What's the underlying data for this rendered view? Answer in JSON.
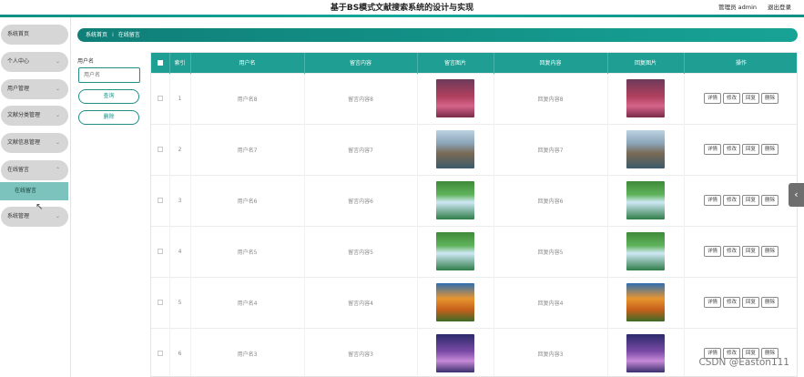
{
  "header": {
    "title": "基于BS模式文献搜索系统的设计与实现",
    "user": "管理员 admin",
    "logout": "退出登录"
  },
  "sidebar": {
    "items": [
      {
        "label": "系统首页",
        "chevron": ""
      },
      {
        "label": "个人中心",
        "chevron": "⌄"
      },
      {
        "label": "用户管理",
        "chevron": "⌄"
      },
      {
        "label": "文献分类管理",
        "chevron": "⌄"
      },
      {
        "label": "文献信息管理",
        "chevron": "⌄"
      },
      {
        "label": "在线留言",
        "chevron": "⌃"
      },
      {
        "label": "系统管理",
        "chevron": "⌄"
      }
    ],
    "active_sub": "在线留言"
  },
  "breadcrumb": {
    "home": "系统首页",
    "sep": "⁞",
    "current": "在线留言"
  },
  "search": {
    "label": "用户名",
    "placeholder": "用户名",
    "query_btn": "查询",
    "delete_btn": "删除"
  },
  "table": {
    "headers": [
      "索引",
      "用户名",
      "留言内容",
      "留言图片",
      "回复内容",
      "回复图片",
      "操作"
    ],
    "actions": [
      "详情",
      "修改",
      "回复",
      "删除"
    ],
    "rows": [
      {
        "index": "1",
        "user": "用户名8",
        "content": "留言内容8",
        "reply": "回复内容8",
        "img": "tree-pink"
      },
      {
        "index": "2",
        "user": "用户名7",
        "content": "留言内容7",
        "reply": "回复内容7",
        "img": "sea-arch"
      },
      {
        "index": "3",
        "user": "用户名6",
        "content": "留言内容6",
        "reply": "回复内容6",
        "img": "waterfall"
      },
      {
        "index": "4",
        "user": "用户名5",
        "content": "留言内容5",
        "reply": "回复内容5",
        "img": "waterfall"
      },
      {
        "index": "5",
        "user": "用户名4",
        "content": "留言内容4",
        "reply": "回复内容4",
        "img": "autumn-tree"
      },
      {
        "index": "6",
        "user": "用户名3",
        "content": "留言内容3",
        "reply": "回复内容3",
        "img": "purple-night"
      }
    ]
  },
  "image_styles": {
    "tree-pink": "linear-gradient(180deg,#6d3a5a 0%,#b0405e 45%,#d5648a 70%,#7a2b48 100%)",
    "sea-arch": "linear-gradient(180deg,#bcd3e3 0%,#8aa3b6 35%,#7a6a55 60%,#3b5b6a 100%)",
    "waterfall": "linear-gradient(180deg,#3f8a3a 0%,#5fb45b 35%,#cfe8f5 55%,#2f7d48 100%)",
    "autumn-tree": "linear-gradient(180deg,#2d6fb0 0%,#e89530 40%,#c45f1a 70%,#3c6b28 100%)",
    "purple-night": "linear-gradient(180deg,#2b2a6a 0%,#7a4aa6 45%,#c78ad8 70%,#3a2f6d 100%)"
  },
  "watermark": "CSDN @Easton111",
  "side_tab_icon": "‹"
}
